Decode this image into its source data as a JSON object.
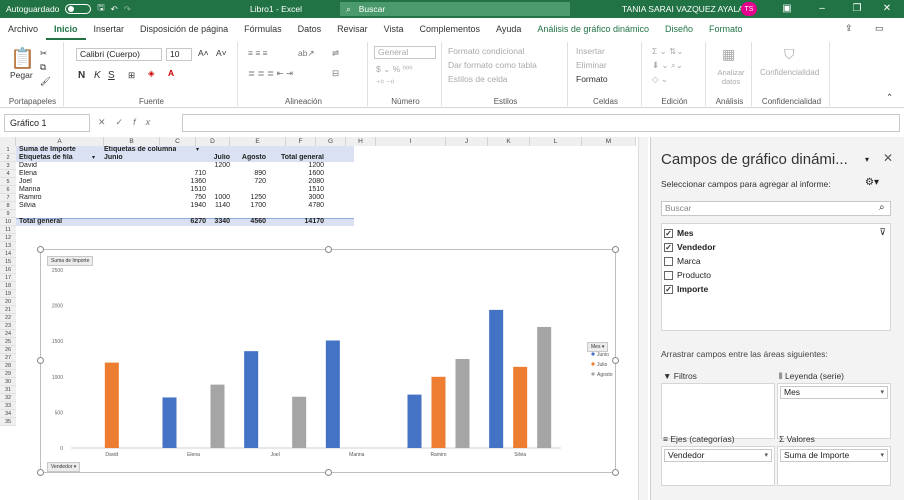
{
  "titlebar": {
    "autosave": "Autoguardado",
    "doc_title": "Libro1  -  Excel",
    "search_placeholder": "Buscar",
    "user": "TANIA SARAI VAZQUEZ AYALA",
    "initials": "TS",
    "bg": "#217346"
  },
  "tabs": [
    "Archivo",
    "Inicio",
    "Insertar",
    "Disposición de página",
    "Fórmulas",
    "Datos",
    "Revisar",
    "Vista",
    "Complementos",
    "Ayuda",
    "Análisis de gráfico dinámico",
    "Diseño",
    "Formato"
  ],
  "ribbon": {
    "paste": "Pegar",
    "font_name": "Calibri (Cuerpo)",
    "font_size": "10",
    "bold": "N",
    "italic": "K",
    "underline": "S",
    "number_format": "General",
    "cond_format": "Formato condicional",
    "format_table": "Dar formato como tabla",
    "cell_styles": "Estilos de celda",
    "insert": "Insertar",
    "delete": "Eliminar",
    "format": "Formato",
    "analyze": "Analizar datos",
    "confidentiality": "Confidencialidad",
    "groups": {
      "clipboard": "Portapapeles",
      "font": "Fuente",
      "alignment": "Alineación",
      "number": "Número",
      "styles": "Estilos",
      "cells": "Celdas",
      "editing": "Edición",
      "analysis": "Análisis",
      "confidentiality": "Confidencialidad"
    }
  },
  "formula": {
    "namebox": "Gráfico 1",
    "fx": "fx"
  },
  "columns": [
    "A",
    "B",
    "C",
    "D",
    "E",
    "F",
    "G",
    "H",
    "I",
    "J",
    "K",
    "L",
    "M"
  ],
  "rows": [
    "1",
    "2",
    "3",
    "4",
    "5",
    "6",
    "7",
    "8",
    "9",
    "10",
    "11",
    "12",
    "13",
    "14",
    "15",
    "16",
    "17",
    "18",
    "19",
    "20",
    "21",
    "22",
    "23",
    "24",
    "25",
    "26",
    "27",
    "28",
    "29",
    "30",
    "31",
    "32",
    "33",
    "34",
    "35"
  ],
  "pivot": {
    "r1a": "Suma de Importe",
    "r1b": "Etiquetas de columna",
    "r2a": "Etiquetas de fila",
    "r2b": "Junio",
    "r2c": "Julio",
    "r2d": "Agosto",
    "r2e": "Total general",
    "data": [
      [
        "David",
        "",
        "1200",
        "",
        "1200"
      ],
      [
        "Elena",
        "710",
        "",
        "890",
        "1600"
      ],
      [
        "Joel",
        "1360",
        "",
        "720",
        "2080"
      ],
      [
        "Marina",
        "1510",
        "",
        "",
        "1510"
      ],
      [
        "Ramiro",
        "750",
        "1000",
        "1250",
        "3000"
      ],
      [
        "Silvia",
        "1940",
        "1140",
        "1700",
        "4780"
      ]
    ],
    "total": [
      "Total general",
      "6270",
      "3340",
      "4560",
      "14170"
    ]
  },
  "chart_data": {
    "type": "bar",
    "title": "",
    "categories": [
      "David",
      "Elena",
      "Joel",
      "Marina",
      "Ramiro",
      "Silvia"
    ],
    "series": [
      {
        "name": "Junio",
        "color": "#4472c4",
        "values": [
          0,
          710,
          1360,
          1510,
          750,
          1940
        ]
      },
      {
        "name": "Julio",
        "color": "#ed7d31",
        "values": [
          1200,
          0,
          0,
          0,
          1000,
          1140
        ]
      },
      {
        "name": "Agosto",
        "color": "#a5a5a5",
        "values": [
          0,
          890,
          720,
          0,
          1250,
          1700
        ]
      }
    ],
    "ylim": [
      0,
      2500
    ],
    "yticks": [
      0,
      500,
      1000,
      1500,
      2000,
      2500
    ],
    "ylabel": "",
    "xlabel": "",
    "grid": false,
    "legend": "right",
    "legend_title": "Mes",
    "field_buttons": {
      "value": "Suma de Importe",
      "axis": "Vendedor"
    }
  },
  "pane": {
    "title": "Campos de gráfico dinámi...",
    "subtitle": "Seleccionar campos para agregar al informe:",
    "search": "Buscar",
    "fields": [
      {
        "label": "Mes",
        "checked": true
      },
      {
        "label": "Vendedor",
        "checked": true
      },
      {
        "label": "Marca",
        "checked": false
      },
      {
        "label": "Producto",
        "checked": false
      },
      {
        "label": "Importe",
        "checked": true
      }
    ],
    "drag_label": "Arrastrar campos entre las áreas siguientes:",
    "areas": {
      "filters": "Filtros",
      "legend": "Leyenda (serie)",
      "legend_value": "Mes",
      "axis": "Ejes (categorías)",
      "axis_value": "Vendedor",
      "values": "Valores",
      "values_value": "Suma de Importe"
    }
  }
}
